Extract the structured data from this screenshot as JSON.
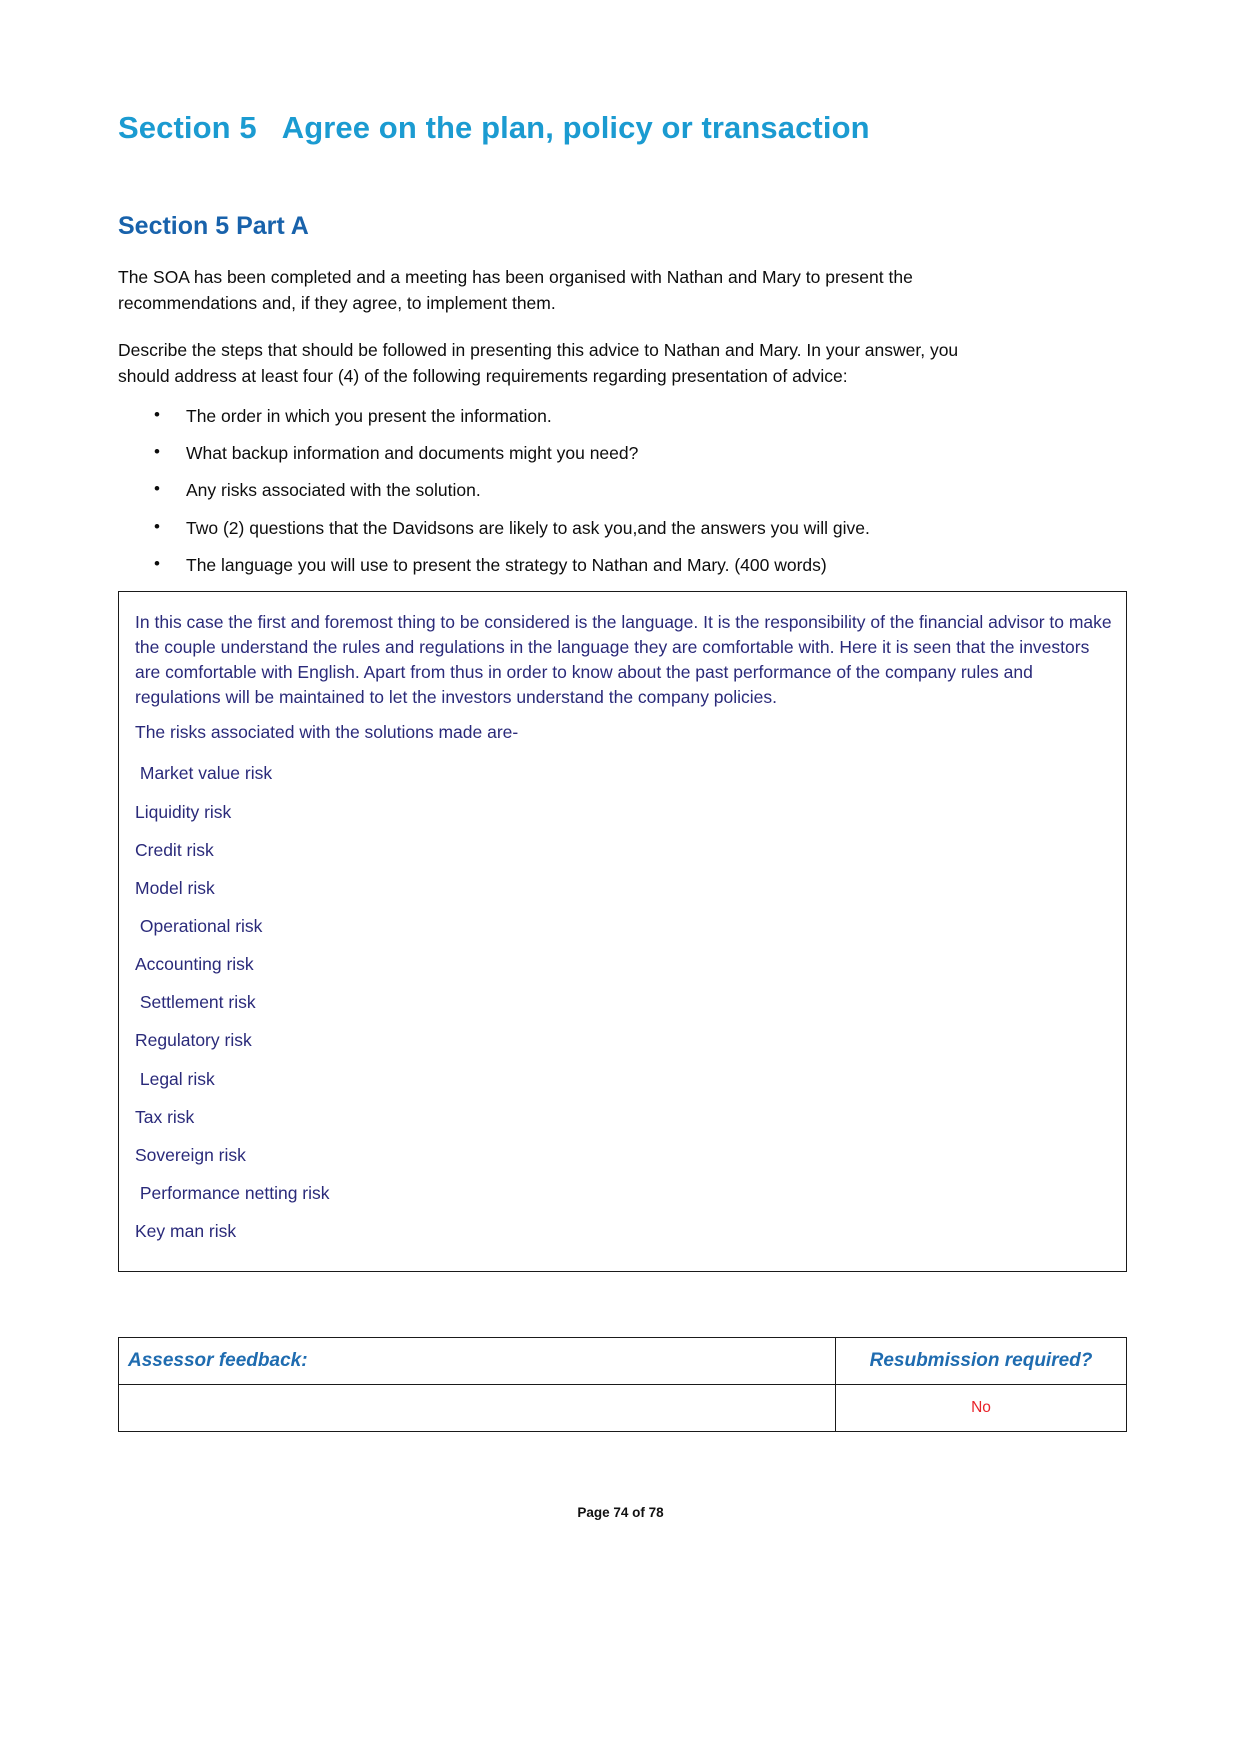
{
  "document": {
    "section_heading": "Section 5   Agree on the plan, policy or transaction",
    "part_heading": "Section 5 Part A",
    "intro_paragraph": "The SOA has been completed and a meeting has been organised with Nathan and Mary to present the recommendations and, if they agree, to implement them.",
    "instruction_paragraph": "Describe the steps that should be followed in presenting this advice to Nathan and Mary. In your answer, you should address at least four (4) of the following requirements regarding presentation of advice:",
    "requirements": [
      "The order in which you present the information.",
      "What backup information and documents might you need?",
      "Any risks associated with the solution.",
      "Two (2) questions that the Davidsons are likely to ask you,and the answers you will give.",
      "The language you will use to present the strategy to Nathan and Mary. (400 words)"
    ]
  },
  "answer": {
    "paragraph_1": "In this case the first and foremost thing to be considered is the language. It is the responsibility of the financial advisor to make the couple understand the rules and regulations in the language they are comfortable with.  Here it is seen that the investors are comfortable with English. Apart from thus in order to know about the past performance of the company rules and regulations will be maintained to let the investors understand the company policies.",
    "paragraph_2": "The risks associated with the solutions made are-",
    "risks": [
      " Market value risk",
      "Liquidity risk",
      "Credit risk",
      "Model risk",
      " Operational risk",
      "Accounting risk",
      " Settlement risk",
      "Regulatory risk",
      " Legal risk",
      "Tax risk",
      "Sovereign risk",
      " Performance netting risk",
      "Key man risk"
    ]
  },
  "feedback_table": {
    "header_left": "Assessor feedback:",
    "header_right": "Resubmission required?",
    "body_left": "",
    "body_right": "No"
  },
  "footer": {
    "page_label": "Page 74 of 78"
  },
  "colors": {
    "section_heading": "#1b9bd1",
    "part_heading": "#1862ab",
    "answer_text": "#2a2a7a",
    "table_header": "#1f6cb0",
    "resubmission_value": "#e8232a"
  }
}
